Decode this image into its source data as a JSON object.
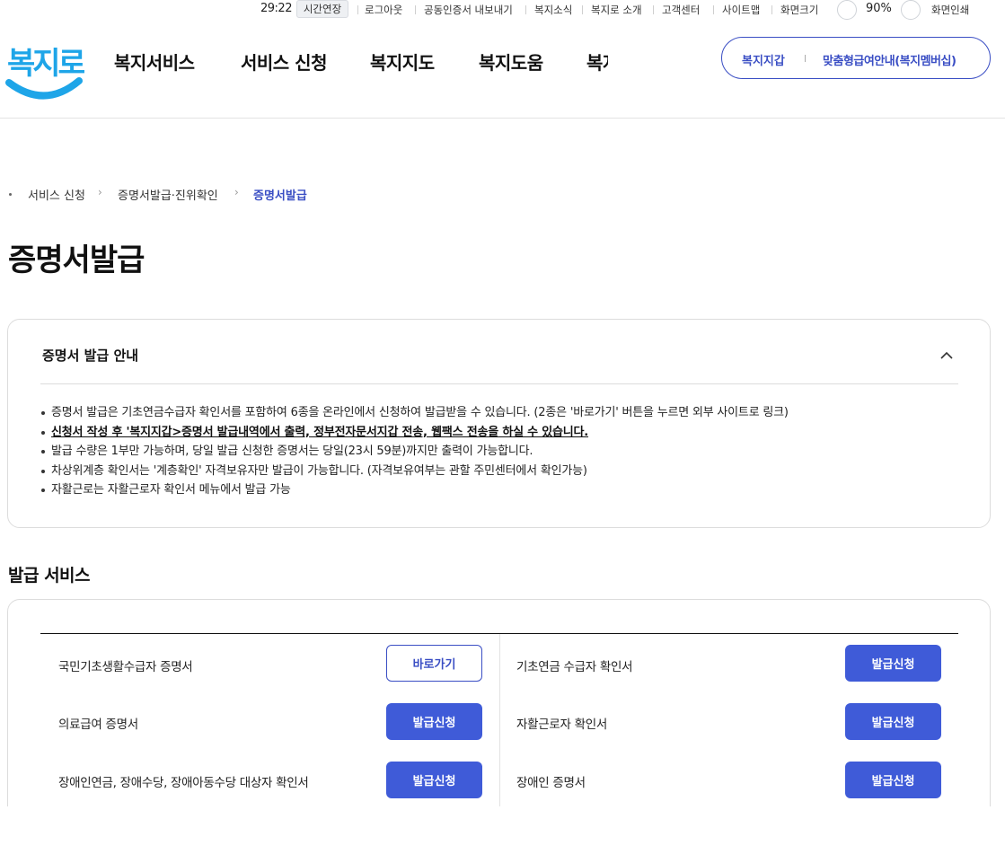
{
  "utility": {
    "timer": "29:22",
    "extend_label": "시간연장",
    "links": [
      "로그아웃",
      "공동인증서 내보내기",
      "복지소식",
      "복지로 소개",
      "고객센터",
      "사이트맵",
      "화면크기"
    ],
    "zoom": "90%",
    "print_label": "화면인쇄"
  },
  "header": {
    "logo_text": "복지로",
    "nav": [
      "복지서비스",
      "서비스 신청",
      "복지지도",
      "복지도움",
      "복지"
    ],
    "wallet_label": "복지지갑",
    "membership_label": "맞춤형급여안내(복지멤버십)"
  },
  "breadcrumb": [
    "서비스 신청",
    "증명서발급·진위확인",
    "증명서발급"
  ],
  "page_title": "증명서발급",
  "guide": {
    "title": "증명서 발급 안내",
    "items": [
      "증명서 발급은 기초연금수급자 확인서를 포함하여 6종을 온라인에서 신청하여 발급받을 수 있습니다. (2종은 '바로가기' 버튼을 누르면 외부 사이트로 링크)",
      "신청서 작성 후 '복지지갑>증명서 발급내역에서 출력, 정부전자문서지갑 전송, 웹팩스 전송을 하실 수 있습니다.",
      "발급 수량은 1부만 가능하며, 당일 발급 신청한 증명서는 당일(23시 59분)까지만 출력이 가능합니다.",
      "차상위계층 확인서는 '계층확인' 자격보유자만 발급이 가능합니다. (자격보유여부는 관할 주민센터에서 확인가능)",
      "자활근로는 자활근로자 확인서 메뉴에서 발급 가능"
    ]
  },
  "service_section_title": "발급 서비스",
  "services": [
    {
      "name": "국민기초생활수급자 증명서",
      "button": "바로가기"
    },
    {
      "name": "기초연금 수급자 확인서",
      "button": "발급신청"
    },
    {
      "name": "의료급여 증명서",
      "button": "발급신청"
    },
    {
      "name": "자활근로자 확인서",
      "button": "발급신청"
    },
    {
      "name": "장애인연금, 장애수당, 장애아동수당 대상자 확인서",
      "button": "발급신청"
    },
    {
      "name": "장애인 증명서",
      "button": "발급신청"
    }
  ],
  "colors": {
    "brand": "#3a4ec4",
    "button": "#3f5bd8",
    "logo_blue": "#1ea5e8"
  }
}
